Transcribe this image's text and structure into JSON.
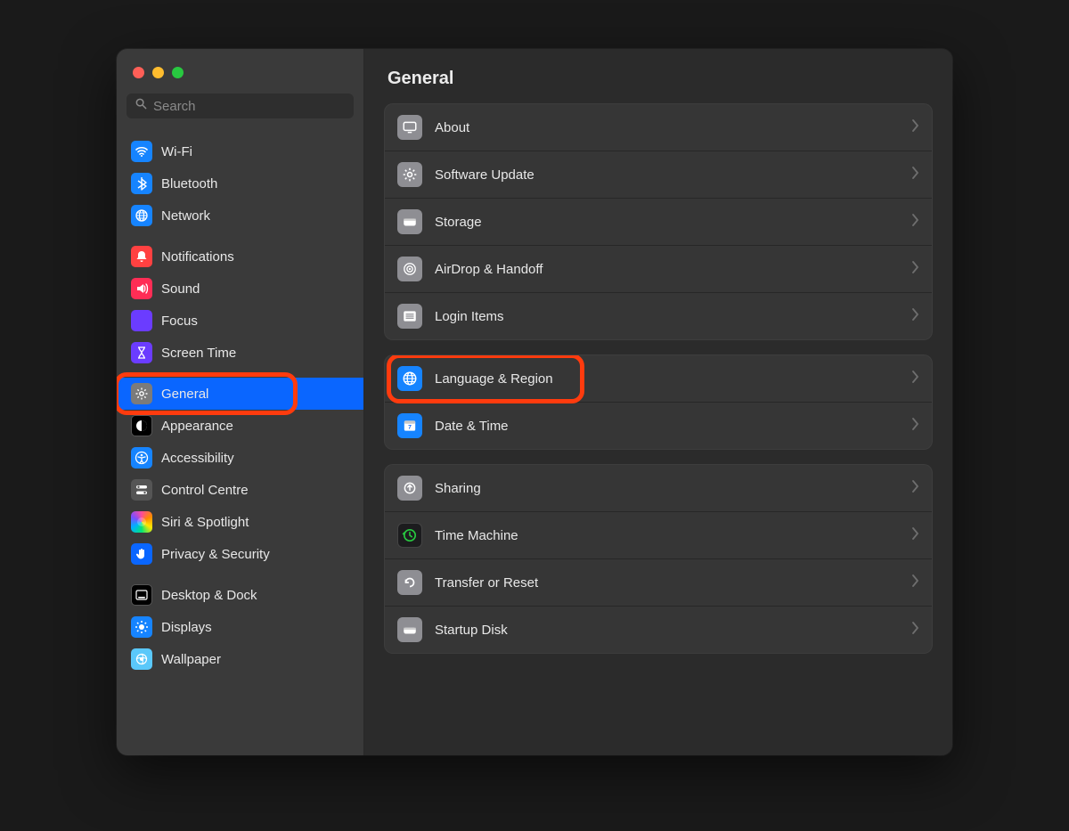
{
  "header": {
    "title": "General"
  },
  "search": {
    "placeholder": "Search"
  },
  "sidebar": {
    "groups": [
      [
        {
          "id": "wifi",
          "label": "Wi-Fi",
          "icon": "wifi-icon",
          "bg": "bg-blue"
        },
        {
          "id": "bluetooth",
          "label": "Bluetooth",
          "icon": "bluetooth-icon",
          "bg": "bg-blue"
        },
        {
          "id": "network",
          "label": "Network",
          "icon": "globe-icon",
          "bg": "bg-blue"
        }
      ],
      [
        {
          "id": "notifications",
          "label": "Notifications",
          "icon": "bell-icon",
          "bg": "bg-red"
        },
        {
          "id": "sound",
          "label": "Sound",
          "icon": "speaker-icon",
          "bg": "bg-pink"
        },
        {
          "id": "focus",
          "label": "Focus",
          "icon": "moon-icon",
          "bg": "bg-purple"
        },
        {
          "id": "screen-time",
          "label": "Screen Time",
          "icon": "hourglass-icon",
          "bg": "bg-purple"
        }
      ],
      [
        {
          "id": "general",
          "label": "General",
          "icon": "gear-icon",
          "bg": "bg-gray",
          "selected": true
        },
        {
          "id": "appearance",
          "label": "Appearance",
          "icon": "appearance-icon",
          "bg": "bg-black"
        },
        {
          "id": "accessibility",
          "label": "Accessibility",
          "icon": "accessibility-icon",
          "bg": "bg-blue"
        },
        {
          "id": "control-centre",
          "label": "Control Centre",
          "icon": "switches-icon",
          "bg": "bg-grayd"
        },
        {
          "id": "siri-spotlight",
          "label": "Siri & Spotlight",
          "icon": "siri-icon",
          "bg": "bg-multi"
        },
        {
          "id": "privacy-security",
          "label": "Privacy & Security",
          "icon": "hand-icon",
          "bg": "bg-blue2"
        }
      ],
      [
        {
          "id": "desktop-dock",
          "label": "Desktop & Dock",
          "icon": "dock-icon",
          "bg": "bg-black"
        },
        {
          "id": "displays",
          "label": "Displays",
          "icon": "brightness-icon",
          "bg": "bg-blue"
        },
        {
          "id": "wallpaper",
          "label": "Wallpaper",
          "icon": "wallpaper-icon",
          "bg": "bg-teal"
        }
      ]
    ]
  },
  "main": {
    "sections": [
      [
        {
          "id": "about",
          "label": "About",
          "icon": "display-icon",
          "bg": "bg-lgray"
        },
        {
          "id": "software-update",
          "label": "Software Update",
          "icon": "gear-icon",
          "bg": "bg-lgray"
        },
        {
          "id": "storage",
          "label": "Storage",
          "icon": "drive-icon",
          "bg": "bg-lgray"
        },
        {
          "id": "airdrop-handoff",
          "label": "AirDrop & Handoff",
          "icon": "airdrop-icon",
          "bg": "bg-lgray"
        },
        {
          "id": "login-items",
          "label": "Login Items",
          "icon": "list-icon",
          "bg": "bg-lgray"
        }
      ],
      [
        {
          "id": "language-region",
          "label": "Language & Region",
          "icon": "globe-icon",
          "bg": "bg-blue",
          "highlighted": true
        },
        {
          "id": "date-time",
          "label": "Date & Time",
          "icon": "calendar-icon",
          "bg": "bg-blue"
        }
      ],
      [
        {
          "id": "sharing",
          "label": "Sharing",
          "icon": "sharing-icon",
          "bg": "bg-lgray"
        },
        {
          "id": "time-machine",
          "label": "Time Machine",
          "icon": "timemachine-icon",
          "bg": "bg-dark"
        },
        {
          "id": "transfer-reset",
          "label": "Transfer or Reset",
          "icon": "reset-icon",
          "bg": "bg-lgray"
        },
        {
          "id": "startup-disk",
          "label": "Startup Disk",
          "icon": "startup-icon",
          "bg": "bg-lgray"
        }
      ]
    ]
  },
  "highlights": {
    "sidebar_item_id": "general",
    "main_row_id": "language-region"
  }
}
